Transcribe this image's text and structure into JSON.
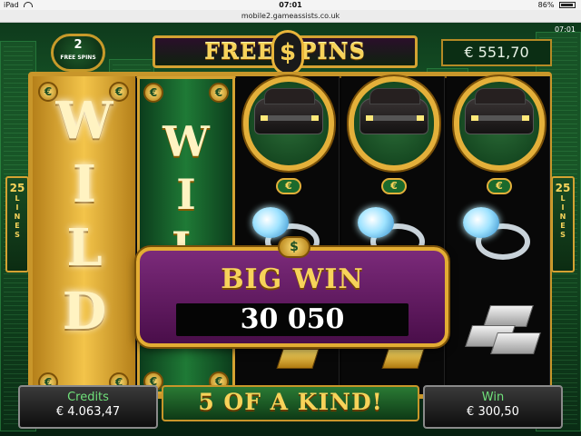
{
  "status_bar": {
    "device": "iPad",
    "time": "07:01",
    "battery": "86%"
  },
  "browser": {
    "url": "mobile2.gameassists.co.uk"
  },
  "game": {
    "clock": "07:01",
    "free_spins": {
      "count": "2",
      "label": "FREE SPINS"
    },
    "title": "FREE SPINS",
    "title_dollar": "$",
    "balance": "€ 551,70",
    "lines": {
      "count": "25",
      "word": "LINES"
    },
    "reels": {
      "wild_letters": [
        "W",
        "I",
        "L",
        "D"
      ],
      "wild_partial": [
        "W",
        "I",
        "L"
      ],
      "coin_symbol": "€",
      "medallion_symbols": [
        "limousine",
        "limousine",
        "limousine"
      ]
    },
    "big_win": {
      "label": "BIG WIN",
      "amount": "30 050",
      "badge": "$"
    },
    "credits": {
      "label": "Credits",
      "value": "€ 4.063,47"
    },
    "win": {
      "label": "Win",
      "value": "€ 300,50"
    },
    "banner": "5 OF A KIND!"
  },
  "icons": [
    "wifi-icon",
    "battery-icon",
    "limousine-icon",
    "diamond-ring-icon",
    "silver-bars-icon",
    "gold-bar-icon",
    "euro-coin-icon",
    "dollar-coin-icon"
  ],
  "colors": {
    "gold": "#d4a232",
    "felt_green": "#1d6b2f",
    "big_win_purple": "#7b2a7a",
    "credits_label": "#6fe07a"
  }
}
